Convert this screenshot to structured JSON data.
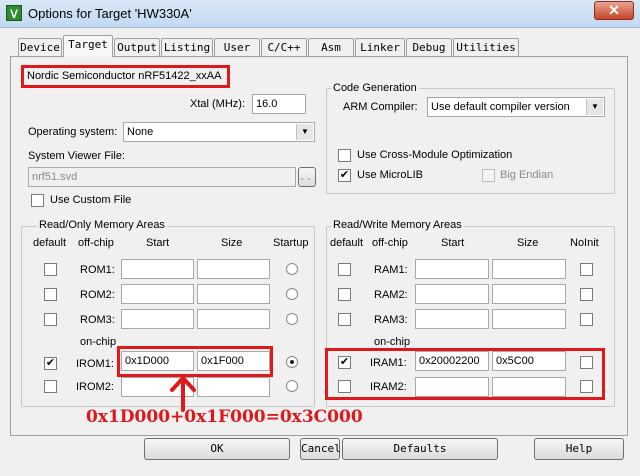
{
  "window": {
    "title": "Options for Target 'HW330A'",
    "icon_glyph": "V",
    "close_glyph": "✕"
  },
  "tabs": [
    {
      "label": "Device"
    },
    {
      "label": "Target"
    },
    {
      "label": "Output"
    },
    {
      "label": "Listing"
    },
    {
      "label": "User"
    },
    {
      "label": "C/C++"
    },
    {
      "label": "Asm"
    },
    {
      "label": "Linker"
    },
    {
      "label": "Debug"
    },
    {
      "label": "Utilities"
    }
  ],
  "active_tab": "Target",
  "device_name": "Nordic Semiconductor nRF51422_xxAA",
  "xtal": {
    "label": "Xtal (MHz):",
    "value": "16.0"
  },
  "os": {
    "label": "Operating system:",
    "value": "None"
  },
  "sysviewer": {
    "label": "System Viewer File:",
    "value": "nrf51.svd",
    "browse_label": "...",
    "custom_label": "Use Custom File"
  },
  "codegen": {
    "title": "Code Generation",
    "compiler_label": "ARM Compiler:",
    "compiler_value": "Use default compiler version",
    "cross_module_label": "Use Cross-Module Optimization",
    "microlib_label": "Use MicroLIB",
    "microlib_checked": true,
    "big_endian_label": "Big Endian"
  },
  "rom": {
    "title": "Read/Only Memory Areas",
    "headers": {
      "default": "default",
      "offchip": "off-chip",
      "start": "Start",
      "size": "Size",
      "startup": "Startup"
    },
    "onchip_label": "on-chip",
    "rows": [
      {
        "name": "ROM1:",
        "start": "",
        "size": "",
        "checked": false,
        "startup": false
      },
      {
        "name": "ROM2:",
        "start": "",
        "size": "",
        "checked": false,
        "startup": false
      },
      {
        "name": "ROM3:",
        "start": "",
        "size": "",
        "checked": false,
        "startup": false
      },
      {
        "name": "IROM1:",
        "start": "0x1D000",
        "size": "0x1F000",
        "checked": true,
        "startup": true
      },
      {
        "name": "IROM2:",
        "start": "",
        "size": "",
        "checked": false,
        "startup": false
      }
    ]
  },
  "ram": {
    "title": "Read/Write Memory Areas",
    "headers": {
      "default": "default",
      "offchip": "off-chip",
      "start": "Start",
      "size": "Size",
      "noinit": "NoInit"
    },
    "onchip_label": "on-chip",
    "rows": [
      {
        "name": "RAM1:",
        "start": "",
        "size": "",
        "checked": false
      },
      {
        "name": "RAM2:",
        "start": "",
        "size": "",
        "checked": false
      },
      {
        "name": "RAM3:",
        "start": "",
        "size": "",
        "checked": false
      },
      {
        "name": "IRAM1:",
        "start": "0x20002200",
        "size": "0x5C00",
        "checked": true
      },
      {
        "name": "IRAM2:",
        "start": "",
        "size": "",
        "checked": false
      }
    ]
  },
  "annotation": {
    "text": "0x1D000+0x1F000=0x3C000",
    "color": "#e0181b"
  },
  "buttons": {
    "ok": "OK",
    "cancel": "Cancel",
    "defaults": "Defaults",
    "help": "Help"
  }
}
